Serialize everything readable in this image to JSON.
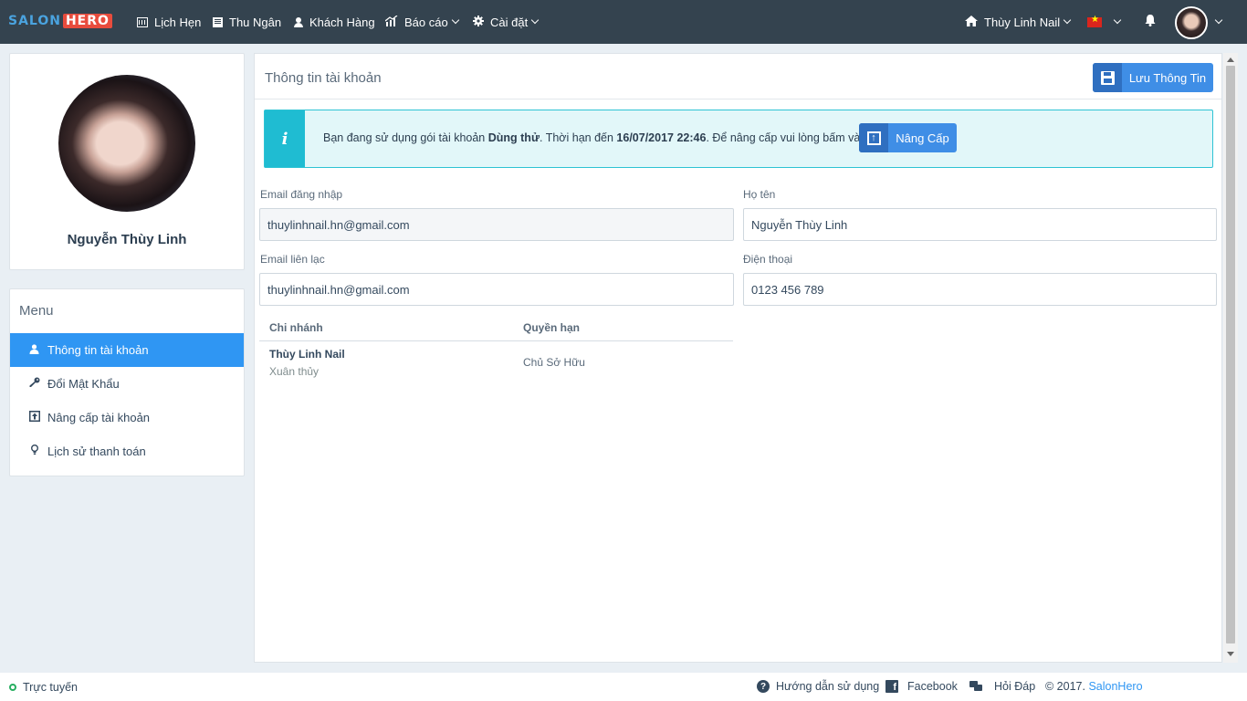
{
  "nav": {
    "logo_part1": "SALON",
    "logo_part2": "HERO",
    "items": [
      {
        "label": "Lịch Hẹn",
        "icon": "calendar-icon"
      },
      {
        "label": "Thu Ngân",
        "icon": "cash-register-icon"
      },
      {
        "label": "Khách Hàng",
        "icon": "user-icon"
      },
      {
        "label": "Báo cáo",
        "icon": "chart-icon"
      },
      {
        "label": "Cài đặt",
        "icon": "gear-icon"
      }
    ],
    "salon_name": "Thùy Linh Nail",
    "language": "vi"
  },
  "profile": {
    "name": "Nguyễn Thùy Linh"
  },
  "menu": {
    "title": "Menu",
    "items": [
      {
        "label": "Thông tin tài khoản",
        "icon": "user-icon",
        "active": true
      },
      {
        "label": "Đổi Mật Khẩu",
        "icon": "key-icon",
        "active": false
      },
      {
        "label": "Nâng cấp tài khoản",
        "icon": "upgrade-icon",
        "active": false
      },
      {
        "label": "Lịch sử thanh toán",
        "icon": "lightbulb-icon",
        "active": false
      }
    ]
  },
  "panel": {
    "title": "Thông tin tài khoản",
    "save_label": "Lưu Thông Tin"
  },
  "alert": {
    "text_1": "Bạn đang sử dụng gói tài khoản ",
    "plan": "Dùng thử",
    "text_2": ". Thời hạn đến ",
    "expiry": "16/07/2017 22:46",
    "text_3": ". Để nâng cấp vui lòng bấm vào đây",
    "upgrade_label": "Nâng Cấp"
  },
  "form": {
    "login_email_label": "Email đăng nhập",
    "login_email_value": "thuylinhnail.hn@gmail.com",
    "fullname_label": "Họ tên",
    "fullname_value": "Nguyễn Thùy Linh",
    "contact_email_label": "Email liên lạc",
    "contact_email_value": "thuylinhnail.hn@gmail.com",
    "phone_label": "Điện thoại",
    "phone_value": "0123 456 789"
  },
  "branches": {
    "headers": [
      "Chi nhánh",
      "Quyền hạn"
    ],
    "rows": [
      {
        "branch": "Thùy Linh Nail",
        "address": "Xuân thủy",
        "role": "Chủ Sở Hữu"
      }
    ]
  },
  "footer": {
    "status": "Trực tuyến",
    "guide": "Hướng dẫn sử dụng",
    "facebook": "Facebook",
    "faq": "Hỏi Đáp",
    "copyright": "© 2017.",
    "brand": "SalonHero"
  },
  "colors": {
    "navbar": "#34434f",
    "accent": "#2f96f3",
    "info": "#1fbcd2",
    "online": "#27ae60"
  }
}
